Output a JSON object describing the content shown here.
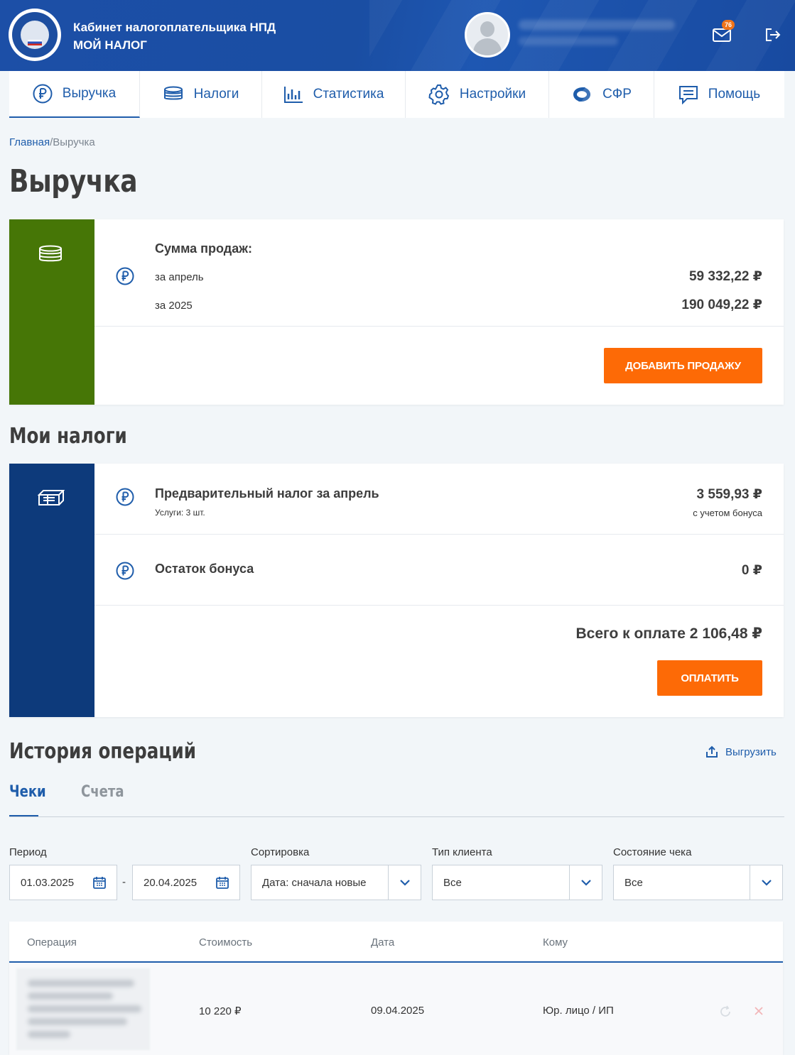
{
  "header": {
    "title_line1": "Кабинет налогоплательщика НПД",
    "title_line2": "МОЙ НАЛОГ",
    "notifications_count": "76",
    "mail_icon": "mail-icon",
    "logout_icon": "logout-icon"
  },
  "nav": {
    "items": [
      {
        "label": "Выручка",
        "icon": "ruble-icon"
      },
      {
        "label": "Налоги",
        "icon": "coins-icon"
      },
      {
        "label": "Статистика",
        "icon": "bar-chart-icon"
      },
      {
        "label": "Настройки",
        "icon": "gear-icon"
      },
      {
        "label": "СФР",
        "icon": "sfr-logo-icon"
      },
      {
        "label": "Помощь",
        "icon": "chat-icon"
      }
    ]
  },
  "breadcrumb": {
    "home": "Главная",
    "separator": "/",
    "current": "Выручка"
  },
  "page_title": "Выручка",
  "sales": {
    "heading": "Сумма продаж:",
    "month_label": "за апрель",
    "month_value": "59 332,22 ₽",
    "year_label": "за 2025",
    "year_value": "190 049,22 ₽",
    "add_button": "ДОБАВИТЬ ПРОДАЖУ",
    "accent_color": "#467606"
  },
  "taxes": {
    "section_title": "Мои налоги",
    "prelim_title": "Предварительный налог за апрель",
    "prelim_sub": "Услуги: 3 шт.",
    "prelim_value": "3 559,93 ₽",
    "prelim_note": "с учетом бонуса",
    "bonus_title": "Остаток бонуса",
    "bonus_value": "0 ₽",
    "total": "Всего к оплате 2 106,48 ₽",
    "pay_button": "ОПЛАТИТЬ",
    "accent_color": "#0d3a7b"
  },
  "history": {
    "section_title": "История операций",
    "export_label": "Выгрузить",
    "tabs": [
      "Чеки",
      "Счета"
    ],
    "filters": {
      "period_label": "Период",
      "date_from": "01.03.2025",
      "date_separator": "-",
      "date_to": "20.04.2025",
      "sort_label": "Сортировка",
      "sort_value": "Дата: сначала новые",
      "client_label": "Тип клиента",
      "client_value": "Все",
      "status_label": "Состояние чека",
      "status_value": "Все"
    },
    "columns": [
      "Операция",
      "Стоимость",
      "Дата",
      "Кому"
    ],
    "rows": [
      {
        "amount": "10 220 ₽",
        "date": "09.04.2025",
        "to": "Юр. лицо / ИП"
      }
    ]
  },
  "colors": {
    "brand_blue": "#1f5dab",
    "orange": "#fd6a06",
    "header_blue": "#1a4ea3"
  }
}
